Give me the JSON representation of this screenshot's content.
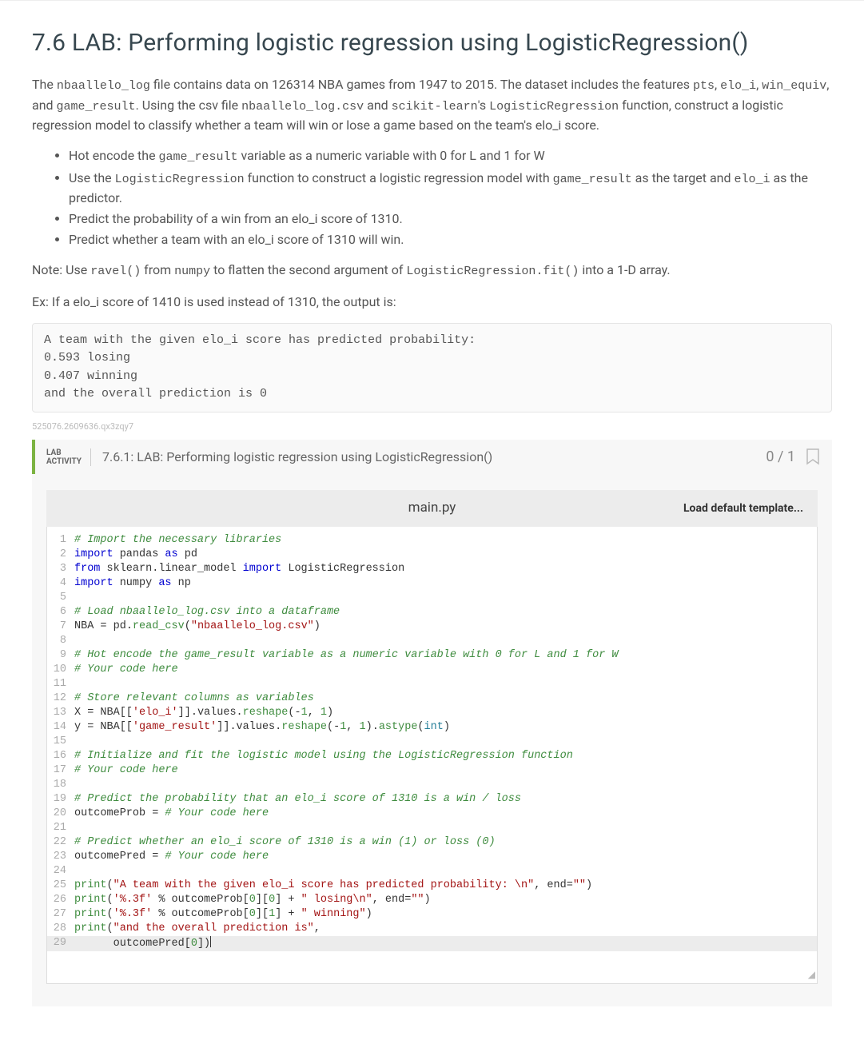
{
  "heading": "7.6 LAB: Performing logistic regression using LogisticRegression()",
  "intro": {
    "p1_a": "The ",
    "p1_code1": "nbaallelo_log",
    "p1_b": " file contains data on 126314 NBA games from 1947 to 2015. The dataset includes the features ",
    "p1_code2": "pts",
    "p1_c": ", ",
    "p1_code3": "elo_i",
    "p1_d": ", ",
    "p1_code4": "win_equiv",
    "p1_e": ", and ",
    "p1_code5": "game_result",
    "p1_f": ". Using the csv file ",
    "p1_code6": "nbaallelo_log.csv",
    "p1_g": " and ",
    "p1_code7": "scikit-learn",
    "p1_h": "'s ",
    "p1_code8": "LogisticRegression",
    "p1_i": " function, construct a logistic regression model to classify whether a team will win or lose a game based on the team's elo_i score."
  },
  "bullets": {
    "b1_a": "Hot encode the ",
    "b1_code": "game_result",
    "b1_b": " variable as a numeric variable with 0 for L and 1 for W",
    "b2_a": "Use the ",
    "b2_code1": "LogisticRegression",
    "b2_b": " function to construct a logistic regression model with ",
    "b2_code2": "game_result",
    "b2_c": " as the target and ",
    "b2_code3": "elo_i",
    "b2_d": " as the predictor.",
    "b3": "Predict the probability of a win from an elo_i score of 1310.",
    "b4": "Predict whether a team with an elo_i score of 1310 will win."
  },
  "note": {
    "a": "Note: Use ",
    "c1": "ravel()",
    "b": " from ",
    "c2": "numpy",
    "c": " to flatten the second argument of ",
    "c3": "LogisticRegression.fit()",
    "d": " into a 1-D array."
  },
  "ex_label": "Ex: If a elo_i score of 1410 is used instead of 1310, the output is:",
  "ex_output": "A team with the given elo_i score has predicted probability:\n0.593 losing\n0.407 winning\nand the overall prediction is 0",
  "hash": "525076.2609636.qx3zqy7",
  "lab": {
    "tag_line1": "LAB",
    "tag_line2": "ACTIVITY",
    "title": "7.6.1: LAB: Performing logistic regression using LogisticRegression()",
    "score": "0 / 1",
    "filename": "main.py",
    "load_template": "Load default template..."
  },
  "code": {
    "l1": {
      "t": "c",
      "v": "# Import the necessary libraries"
    },
    "l2a": "import",
    "l2b": " pandas ",
    "l2c": "as",
    "l2d": " pd",
    "l3a": "from",
    "l3b": " sklearn.linear_model ",
    "l3c": "import",
    "l3d": " LogisticRegression",
    "l4a": "import",
    "l4b": " numpy ",
    "l4c": "as",
    "l4d": " np",
    "l6": "# Load nbaallelo_log.csv into a dataframe",
    "l7a": "NBA = pd.",
    "l7b": "read_csv",
    "l7c": "(",
    "l7d": "\"nbaallelo_log.csv\"",
    "l7e": ")",
    "l9": "# Hot encode the game_result variable as a numeric variable with 0 for L and 1 for W",
    "l10": "# Your code here",
    "l12": "# Store relevant columns as variables",
    "l13a": "X = NBA[[",
    "l13b": "'elo_i'",
    "l13c": "]].values.",
    "l13d": "reshape",
    "l13e": "(-",
    "l13f": "1",
    "l13g": ", ",
    "l13h": "1",
    "l13i": ")",
    "l14a": "y = NBA[[",
    "l14b": "'game_result'",
    "l14c": "]].values.",
    "l14d": "reshape",
    "l14e": "(-",
    "l14f": "1",
    "l14g": ", ",
    "l14h": "1",
    "l14i": ").",
    "l14j": "astype",
    "l14k": "(",
    "l14l": "int",
    "l14m": ")",
    "l16": "# Initialize and fit the logistic model using the LogisticRegression function",
    "l17": "# Your code here",
    "l19": "# Predict the probability that an elo_i score of 1310 is a win / loss",
    "l20a": "outcomeProb = ",
    "l20b": "# Your code here",
    "l22": "# Predict whether an elo_i score of 1310 is a win (1) or loss (0)",
    "l23a": "outcomePred = ",
    "l23b": "# Your code here",
    "l25a": "print",
    "l25b": "(",
    "l25c": "\"A team with the given elo_i score has predicted probability: \\n\"",
    "l25d": ", end=",
    "l25e": "\"\"",
    "l25f": ")",
    "l26a": "print",
    "l26b": "(",
    "l26c": "'%.3f'",
    "l26d": " % outcomeProb[",
    "l26e": "0",
    "l26f": "][",
    "l26g": "0",
    "l26h": "] + ",
    "l26i": "\" losing\\n\"",
    "l26j": ", end=",
    "l26k": "\"\"",
    "l26l": ")",
    "l27a": "print",
    "l27b": "(",
    "l27c": "'%.3f'",
    "l27d": " % outcomeProb[",
    "l27e": "0",
    "l27f": "][",
    "l27g": "1",
    "l27h": "] + ",
    "l27i": "\" winning\"",
    "l27j": ")",
    "l28a": "print",
    "l28b": "(",
    "l28c": "\"and the overall prediction is\"",
    "l28d": ",",
    "l29a": "      outcomePred[",
    "l29b": "0",
    "l29c": "])"
  },
  "linenums": [
    "1",
    "2",
    "3",
    "4",
    "5",
    "6",
    "7",
    "8",
    "9",
    "10",
    "11",
    "12",
    "13",
    "14",
    "15",
    "16",
    "17",
    "18",
    "19",
    "20",
    "21",
    "22",
    "23",
    "24",
    "25",
    "26",
    "27",
    "28",
    "29"
  ]
}
